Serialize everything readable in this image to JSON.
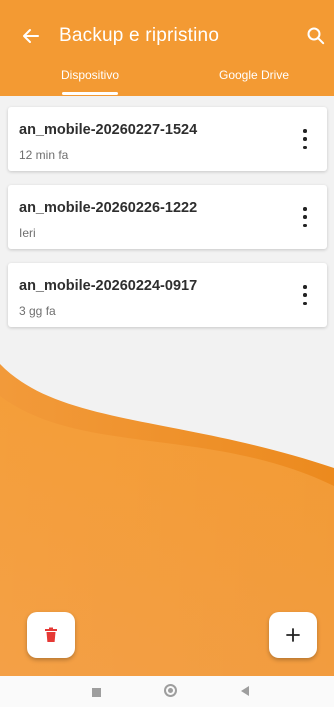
{
  "header": {
    "title": "Backup e ripristino",
    "back_icon": "arrow-left-icon",
    "search_icon": "search-icon"
  },
  "tabs": [
    {
      "label": "Dispositivo",
      "selected": true
    },
    {
      "label": "Google Drive",
      "selected": false
    }
  ],
  "backups": [
    {
      "name": "an_mobile-20260227-1524",
      "age": "12 min fa"
    },
    {
      "name": "an_mobile-20260226-1222",
      "age": "Ieri"
    },
    {
      "name": "an_mobile-20260224-0917",
      "age": "3 gg fa"
    }
  ],
  "actions": {
    "delete_icon": "trash-icon",
    "add_label": "+"
  },
  "colors": {
    "primary": "#f39a33",
    "wave_light": "#f7a63e",
    "wave_dark": "#ee8a1e",
    "delete": "#e53935"
  },
  "system_nav": [
    "recents-icon",
    "home-icon",
    "back-icon"
  ]
}
